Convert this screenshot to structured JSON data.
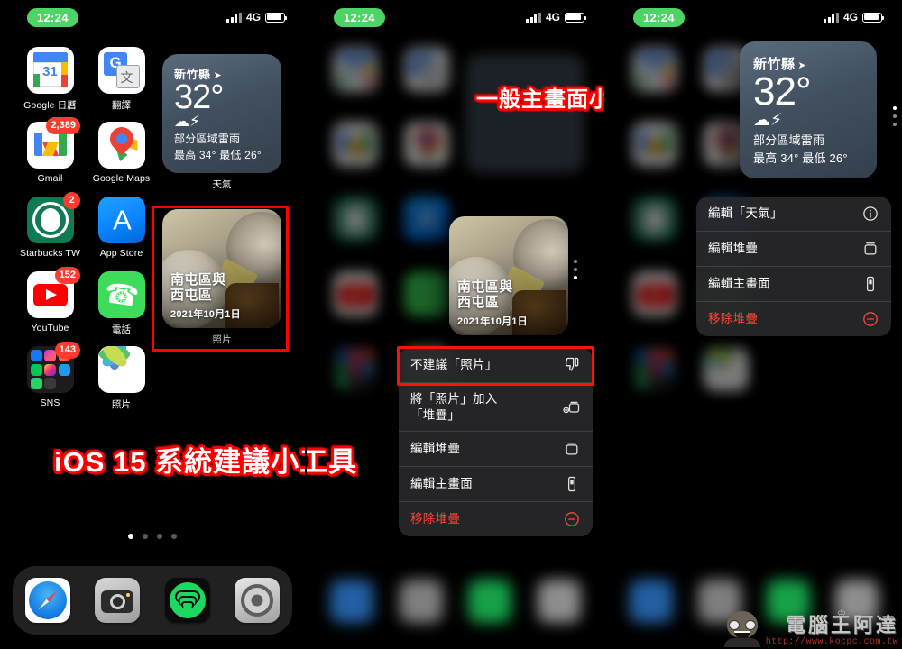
{
  "statusbar": {
    "time": "12:24",
    "network": "4G",
    "signal_icon": "cellular-bars-icon",
    "battery_icon": "battery-icon"
  },
  "panel1": {
    "apps": [
      [
        {
          "label": "Google 日曆",
          "icon": "google-calendar-icon",
          "badge": ""
        },
        {
          "label": "翻譯",
          "icon": "google-translate-icon",
          "badge": ""
        }
      ],
      [
        {
          "label": "Gmail",
          "icon": "gmail-icon",
          "badge": "2,389"
        },
        {
          "label": "Google Maps",
          "icon": "google-maps-icon",
          "badge": ""
        }
      ],
      [
        {
          "label": "Starbucks TW",
          "icon": "starbucks-icon",
          "badge": "2"
        },
        {
          "label": "App Store",
          "icon": "app-store-icon",
          "badge": ""
        }
      ],
      [
        {
          "label": "YouTube",
          "icon": "youtube-icon",
          "badge": "152"
        },
        {
          "label": "電話",
          "icon": "phone-icon",
          "badge": ""
        }
      ],
      [
        {
          "label": "SNS",
          "icon": "folder-sns-icon",
          "badge": "143"
        },
        {
          "label": "照片",
          "icon": "photos-icon",
          "badge": ""
        }
      ]
    ],
    "weather": {
      "city": "新竹縣",
      "location_arrow": "location-arrow-icon",
      "temp": "32°",
      "condition_icon": "thunderstorm-cloud-icon",
      "condition": "部分區域雷雨",
      "highlow": "最高 34° 最低 26°",
      "widget_name": "天氣"
    },
    "photos_widget": {
      "title": "南屯區與\n西屯區",
      "title_line1": "南屯區與",
      "title_line2": "西屯區",
      "date": "2021年10月1日",
      "widget_name": "照片"
    },
    "page_dots": {
      "count": 4,
      "active": 1
    },
    "dock": [
      {
        "label": "Safari",
        "icon": "safari-icon"
      },
      {
        "label": "相機",
        "icon": "camera-icon"
      },
      {
        "label": "Spotify",
        "icon": "spotify-icon"
      },
      {
        "label": "設定",
        "icon": "settings-gear-icon"
      }
    ]
  },
  "panel2": {
    "photos_widget": {
      "title_line1": "南屯區與",
      "title_line2": "西屯區",
      "date": "2021年10月1日"
    },
    "context_menu": [
      {
        "label": "不建議「照片」",
        "icon": "thumbs-down-icon",
        "destructive": false,
        "highlighted": true
      },
      {
        "label": "將「照片」加入\n「堆疊」",
        "label_line1": "將「照片」加入",
        "label_line2": "「堆疊」",
        "icon": "add-to-stack-icon",
        "destructive": false
      },
      {
        "label": "編輯堆疊",
        "icon": "stack-icon",
        "destructive": false
      },
      {
        "label": "編輯主畫面",
        "icon": "home-screen-icon",
        "destructive": false
      },
      {
        "label": "移除堆疊",
        "icon": "remove-circle-icon",
        "destructive": true
      }
    ]
  },
  "panel3": {
    "weather": {
      "city": "新竹縣",
      "temp": "32°",
      "condition": "部分區域雷雨",
      "highlow": "最高 34° 最低 26°"
    },
    "context_menu": [
      {
        "label": "編輯「天氣」",
        "icon": "info-circle-icon",
        "destructive": false
      },
      {
        "label": "編輯堆疊",
        "icon": "stack-icon",
        "destructive": false
      },
      {
        "label": "編輯主畫面",
        "icon": "home-screen-icon",
        "destructive": false
      },
      {
        "label": "移除堆疊",
        "icon": "remove-circle-icon",
        "destructive": true
      }
    ]
  },
  "annotations": {
    "ios15_suggestion": "iOS 15 系統建議小工具",
    "normal_widget": "一般主畫面小工具"
  },
  "watermark": {
    "name": "電腦王阿達",
    "url": "http://www.kocpc.com.tw",
    "crown_icon": "crown-icon"
  },
  "colors": {
    "annotation_red": "#ff0000",
    "destructive_red": "#ff453a",
    "badge_red": "#ff3b30",
    "clock_green": "#4cd464",
    "widget_bg": "#41505f"
  }
}
